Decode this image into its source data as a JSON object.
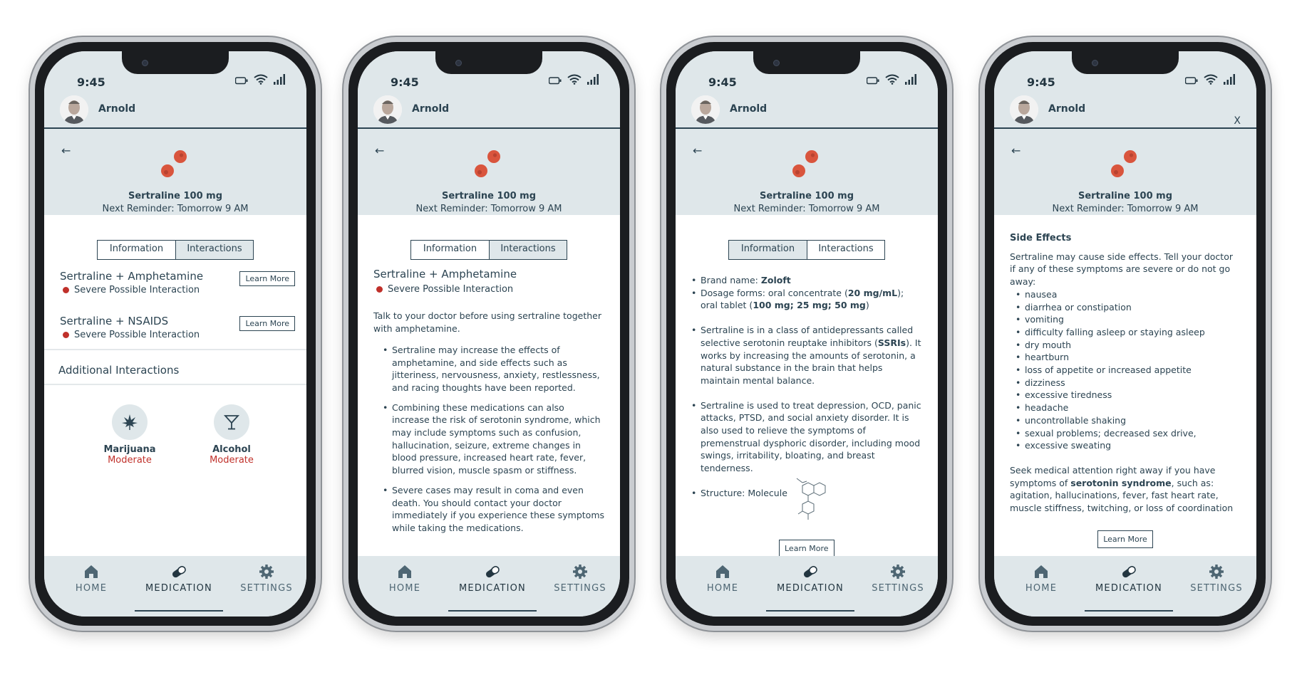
{
  "status": {
    "time": "9:45"
  },
  "user": {
    "name": "Arnold"
  },
  "medication": {
    "name": "Sertraline 100 mg",
    "reminder": "Next Reminder: Tomorrow 9 AM"
  },
  "tabs": {
    "information": "Information",
    "interactions": "Interactions"
  },
  "nav": {
    "home": "HOME",
    "medication": "MEDICATION",
    "settings": "SETTINGS"
  },
  "learn_more": "Learn More",
  "close_label": "X",
  "screen1": {
    "interactions": [
      {
        "title": "Sertraline +  Amphetamine",
        "severity": "Severe Possible Interaction"
      },
      {
        "title": "Sertraline +  NSAIDS",
        "severity": "Severe Possible Interaction"
      }
    ],
    "additional_title": "Additional Interactions",
    "additional": [
      {
        "name": "Marijuana",
        "level": "Moderate",
        "icon": "cannabis-icon"
      },
      {
        "name": "Alcohol",
        "level": "Moderate",
        "icon": "cocktail-icon"
      }
    ]
  },
  "screen2": {
    "title": "Sertraline +  Amphetamine",
    "severity": "Severe Possible Interaction",
    "intro": "Talk to your doctor before using sertraline together with amphetamine.",
    "bullets": [
      "Sertraline may increase the effects of amphetamine, and side effects such as jitteriness, nervousness, anxiety, restlessness, and racing thoughts have been reported.",
      "Combining these medications can also increase the risk of serotonin syndrome, which may include symptoms such as confusion, hallucination, seizure, extreme changes in blood pressure, increased heart rate, fever, blurred vision, muscle spasm or stiffness.",
      "Severe cases may result in coma and even death. You should contact your doctor immediately if you experience these symptoms while taking the medications."
    ]
  },
  "screen3": {
    "brand_prefix": "Brand name: ",
    "brand": "Zoloft",
    "dosage_prefix": "Dosage forms: oral concentrate (",
    "dosage_conc": "20 mg/mL",
    "dosage_mid": "); oral tablet (",
    "dosage_tabs": "100 mg; 25 mg; 50 mg",
    "dosage_end": ")",
    "ssri_prefix": "Sertraline is in a class of antidepressants called selective serotonin reuptake inhibitors (",
    "ssri": "SSRIs",
    "ssri_suffix": "). It works by increasing the amounts of serotonin, a natural substance in the brain that helps maintain mental balance.",
    "uses": "Sertraline is used to treat depression, OCD, panic attacks, PTSD, and social anxiety disorder. It is also used to relieve the symptoms of premenstrual dysphoric disorder, including mood swings, irritability, bloating, and breast tenderness.",
    "structure": "Structure: Molecule"
  },
  "screen4": {
    "heading": "Side Effects",
    "intro": "Sertraline may cause side effects. Tell your doctor if any of these symptoms are severe or do not go away:",
    "effects": [
      "nausea",
      "diarrhea or constipation",
      "vomiting",
      "difficulty falling asleep or staying asleep",
      "dry mouth",
      "heartburn",
      "loss of appetite or increased appetite",
      "dizziness",
      "excessive tiredness",
      "headache",
      "uncontrollable shaking",
      "sexual problems; decreased sex drive,",
      "excessive sweating"
    ],
    "seek_prefix": "Seek medical attention right away if you have symptoms of ",
    "seek_bold": "serotonin syndrome",
    "seek_suffix": ", such as: agitation, hallucinations, fever, fast heart rate, muscle stiffness, twitching, or loss of coordination"
  },
  "colors": {
    "accent": "#2c4452",
    "header_bg": "#dfe7ea",
    "severe": "#c0302a",
    "pill": "#d9553d"
  }
}
